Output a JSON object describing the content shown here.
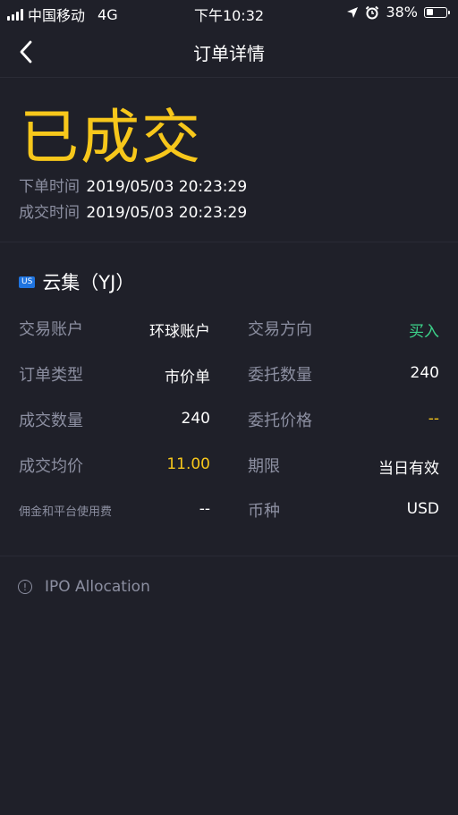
{
  "status_bar": {
    "carrier": "中国移动",
    "network": "4G",
    "time": "下午10:32",
    "battery": "38%",
    "battery_level": 0.38
  },
  "nav": {
    "title": "订单详情",
    "back_icon": "chevron-left-icon"
  },
  "order": {
    "status": "已成交",
    "status_color": "#f7c71b",
    "order_time_label": "下单时间",
    "order_time": "2019/05/03 20:23:29",
    "fill_time_label": "成交时间",
    "fill_time": "2019/05/03 20:23:29"
  },
  "stock": {
    "market_badge": "US",
    "name": "云集（YJ）"
  },
  "details": {
    "account_label": "交易账户",
    "account": "环球账户",
    "direction_label": "交易方向",
    "direction": "买入",
    "direction_color": "#3cd38a",
    "order_type_label": "订单类型",
    "order_type": "市价单",
    "order_qty_label": "委托数量",
    "order_qty": "240",
    "filled_qty_label": "成交数量",
    "filled_qty": "240",
    "order_price_label": "委托价格",
    "order_price": "--",
    "avg_price_label": "成交均价",
    "avg_price": "11.00",
    "period_label": "期限",
    "period": "当日有效",
    "fees_label": "佣金和平台使用费",
    "fees": "--",
    "currency_label": "币种",
    "currency": "USD"
  },
  "ipo": {
    "icon": "info-icon",
    "label": "IPO Allocation"
  }
}
